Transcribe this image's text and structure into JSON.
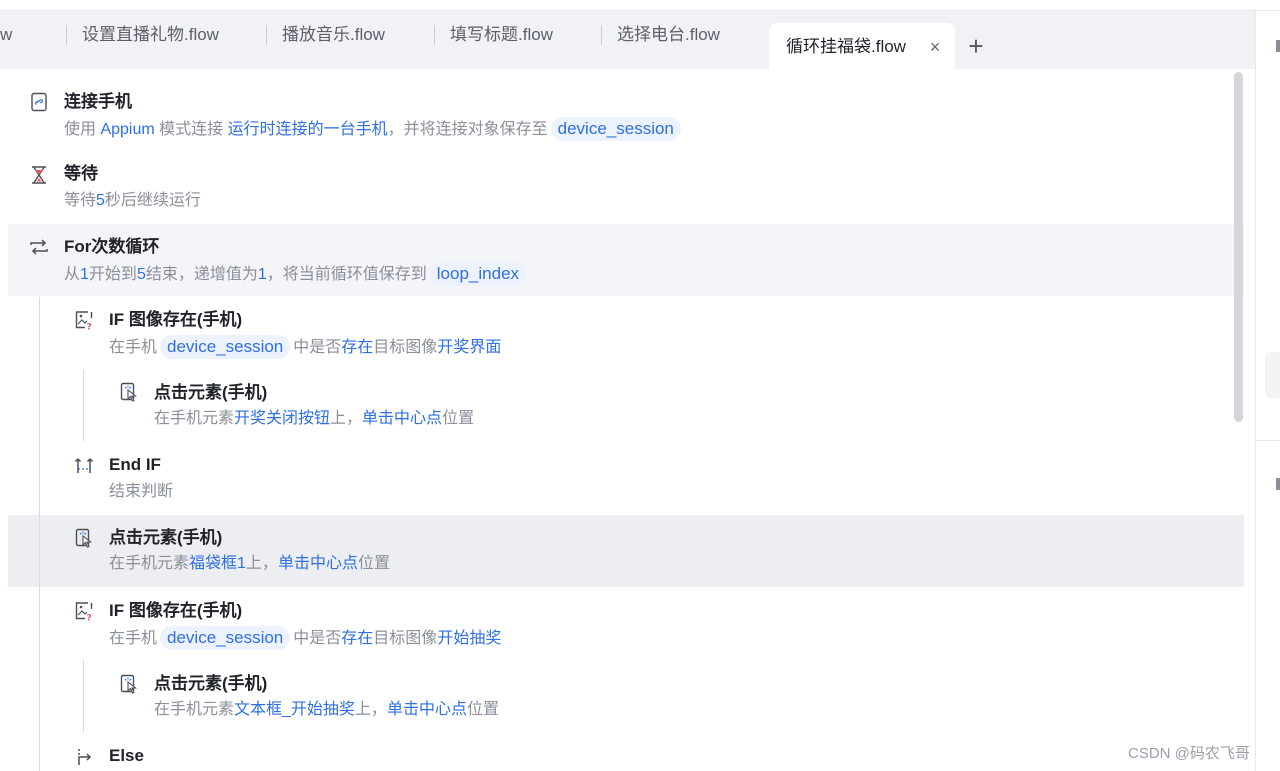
{
  "tabs": {
    "partial_label": "w",
    "items": [
      {
        "label": "设置直播礼物.flow"
      },
      {
        "label": "播放音乐.flow"
      },
      {
        "label": "填写标题.flow"
      },
      {
        "label": "选择电台.flow"
      }
    ],
    "active": {
      "label": "循环挂福袋.flow",
      "close": "×"
    },
    "add": "+"
  },
  "steps": [
    {
      "title": "连接手机",
      "desc": {
        "p1": "使用 ",
        "h1": "Appium",
        "p2": " 模式连接 ",
        "h2": "运行时连接的一台手机",
        "p3": "，并将连接对象保存至",
        "pill": "device_session"
      }
    },
    {
      "title": "等待",
      "desc": {
        "p1": "等待",
        "h1": "5",
        "p2": "秒后继续运行"
      }
    },
    {
      "title": "For次数循环",
      "desc": {
        "p1": "从",
        "h1": "1",
        "p2": "开始到",
        "h2": "5",
        "p3": "结束，递增值为",
        "h3": "1",
        "p4": "，将当前循环值保存到",
        "pill": "loop_index"
      }
    },
    {
      "title": "IF 图像存在(手机)",
      "desc": {
        "p1": "在手机",
        "pill": "device_session",
        "p2": "中是否",
        "h1": "存在",
        "p3": "目标图像",
        "h2": "开奖界面"
      }
    },
    {
      "title": "点击元素(手机)",
      "desc": {
        "p1": "在手机元素",
        "h1": "开奖关闭按钮",
        "p2": "上，",
        "h2": "单击中心点",
        "p3": "位置"
      }
    },
    {
      "title": "End IF",
      "desc": {
        "p1": "结束判断"
      }
    },
    {
      "title": "点击元素(手机)",
      "desc": {
        "p1": "在手机元素",
        "h1": "福袋框1",
        "p2": "上，",
        "h2": "单击中心点",
        "p3": "位置"
      }
    },
    {
      "title": "IF 图像存在(手机)",
      "desc": {
        "p1": "在手机",
        "pill": "device_session",
        "p2": "中是否",
        "h1": "存在",
        "p3": "目标图像",
        "h2": "开始抽奖"
      }
    },
    {
      "title": "点击元素(手机)",
      "desc": {
        "p1": "在手机元素",
        "h1": "文本框_开始抽奖",
        "p2": "上，",
        "h2": "单击中心点",
        "p3": "位置"
      }
    },
    {
      "title": "Else"
    }
  ],
  "watermark": "CSDN @码农飞哥",
  "colors": {
    "accent": "#2f6fe4",
    "pill_bg": "#ecf2fe",
    "muted": "#8a8f99",
    "title": "#1f2329"
  }
}
